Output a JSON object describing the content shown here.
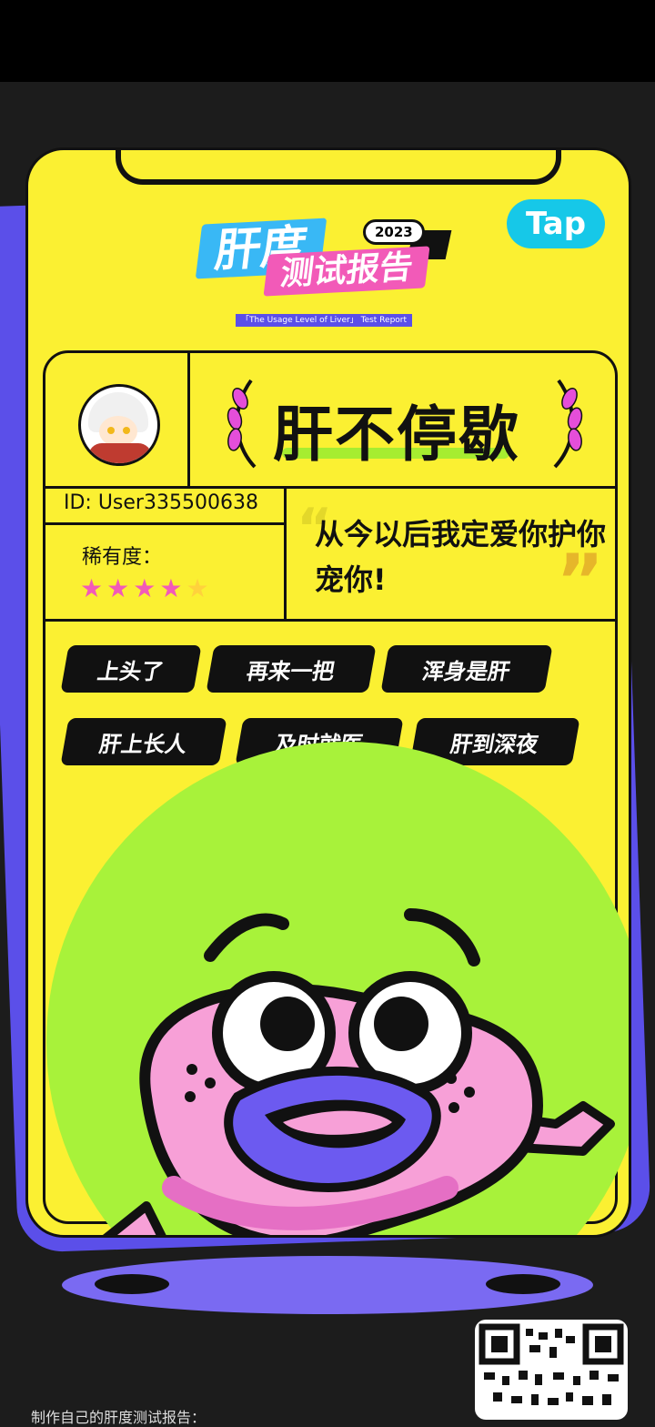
{
  "brand": {
    "badge_label": "Tap",
    "title_main": "肝度",
    "title_year": "2023",
    "title_sub": "测试报告",
    "title_en": "「The Usage Level of Liver」 Test Report"
  },
  "profile": {
    "rank_title": "肝不停歇",
    "user_id": "ID: User335500638",
    "rarity_label": "稀有度：",
    "rarity_stars_filled": 4,
    "rarity_stars_total": 5,
    "quote": "从今以后我定爱你护你宠你!"
  },
  "tags": [
    "上头了",
    "再来一把",
    "浑身是肝",
    "肝上长人",
    "及时就医",
    "肝到深夜"
  ],
  "footer": {
    "cta_text": "制作自己的肝度测试报告："
  },
  "colors": {
    "yellow": "#fbf032",
    "purple": "#5b4fe9",
    "pink": "#f25ab8",
    "green": "#a8f23a",
    "blue": "#39b8f5"
  }
}
